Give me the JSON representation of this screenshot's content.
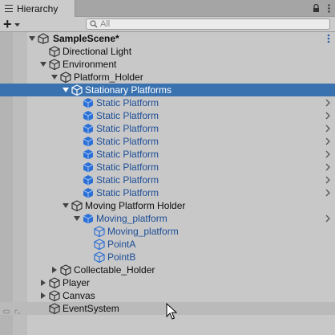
{
  "window": {
    "tab_label": "Hierarchy",
    "tab_icons": [
      "hamburger-icon",
      "lock-icon",
      "kebab-menu-icon"
    ]
  },
  "toolbar": {
    "add_label": "+",
    "search_placeholder": "All",
    "search_value": ""
  },
  "colors": {
    "selection": "#3a72b0",
    "prefab_text": "#1c4d96",
    "prefab_icon": "#2c6fd6",
    "background": "#c8c8c8",
    "tab_bar": "#a5a5a5"
  },
  "tree": {
    "scene": {
      "label": "SampleScene*",
      "expanded": true
    },
    "items": [
      {
        "label": "Directional Light",
        "depth": 1,
        "arrow": "none",
        "type": "object"
      },
      {
        "label": "Environment",
        "depth": 1,
        "arrow": "down",
        "type": "object"
      },
      {
        "label": "Platform_Holder",
        "depth": 2,
        "arrow": "down",
        "type": "object"
      },
      {
        "label": "Stationary Platforms",
        "depth": 3,
        "arrow": "down",
        "type": "object",
        "selected": true
      },
      {
        "label": "Static Platform",
        "depth": 4,
        "arrow": "none",
        "type": "prefab",
        "chevron": true
      },
      {
        "label": "Static Platform",
        "depth": 4,
        "arrow": "none",
        "type": "prefab",
        "chevron": true
      },
      {
        "label": "Static Platform",
        "depth": 4,
        "arrow": "none",
        "type": "prefab",
        "chevron": true
      },
      {
        "label": "Static Platform",
        "depth": 4,
        "arrow": "none",
        "type": "prefab",
        "chevron": true
      },
      {
        "label": "Static Platform",
        "depth": 4,
        "arrow": "none",
        "type": "prefab",
        "chevron": true
      },
      {
        "label": "Static Platform",
        "depth": 4,
        "arrow": "none",
        "type": "prefab",
        "chevron": true
      },
      {
        "label": "Static Platform",
        "depth": 4,
        "arrow": "none",
        "type": "prefab",
        "chevron": true
      },
      {
        "label": "Static Platform",
        "depth": 4,
        "arrow": "none",
        "type": "prefab",
        "chevron": true
      },
      {
        "label": "Moving Platform Holder",
        "depth": 3,
        "arrow": "down",
        "type": "object"
      },
      {
        "label": "Moving_platform",
        "depth": 4,
        "arrow": "down",
        "type": "prefab",
        "chevron": true
      },
      {
        "label": "Moving_platform",
        "depth": 5,
        "arrow": "none",
        "type": "prefab-child"
      },
      {
        "label": "PointA",
        "depth": 5,
        "arrow": "none",
        "type": "prefab-child"
      },
      {
        "label": "PointB",
        "depth": 5,
        "arrow": "none",
        "type": "prefab-child"
      },
      {
        "label": "Collectable_Holder",
        "depth": 2,
        "arrow": "right",
        "type": "object"
      },
      {
        "label": "Player",
        "depth": 1,
        "arrow": "right",
        "type": "object"
      },
      {
        "label": "Canvas",
        "depth": 1,
        "arrow": "right",
        "type": "object"
      },
      {
        "label": "EventSystem",
        "depth": 1,
        "arrow": "none",
        "type": "object",
        "hover": true
      }
    ]
  }
}
